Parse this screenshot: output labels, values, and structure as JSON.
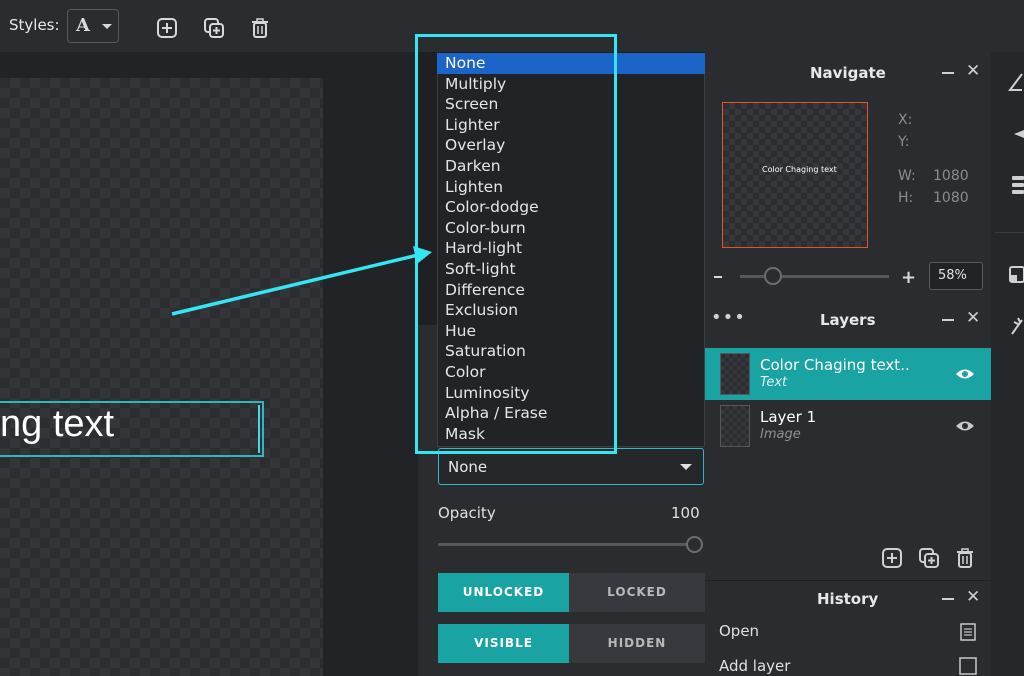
{
  "toolbar": {
    "styles_label": "Styles:",
    "styles_glyph": "A",
    "icons": [
      "add-square-icon",
      "duplicate-icon",
      "trash-icon"
    ]
  },
  "canvas": {
    "visible_text": "ng text"
  },
  "blend_mode": {
    "options": [
      "None",
      "Multiply",
      "Screen",
      "Lighter",
      "Overlay",
      "Darken",
      "Lighten",
      "Color-dodge",
      "Color-burn",
      "Hard-light",
      "Soft-light",
      "Difference",
      "Exclusion",
      "Hue",
      "Saturation",
      "Color",
      "Luminosity",
      "Alpha / Erase",
      "Mask"
    ],
    "selected": "None",
    "highlight_color": "#35e6f2"
  },
  "properties": {
    "opacity_label": "Opacity",
    "opacity_value": "100",
    "opacity_fraction": 1.0,
    "lock": {
      "unlocked": "UNLOCKED",
      "locked": "LOCKED",
      "active": "unlocked"
    },
    "visibility": {
      "visible": "VISIBLE",
      "hidden": "HIDDEN",
      "active": "visible"
    }
  },
  "navigate": {
    "title": "Navigate",
    "preview_text": "Color Chaging text",
    "x_label": "X:",
    "y_label": "Y:",
    "w_label": "W:",
    "w_value": "1080",
    "h_label": "H:",
    "h_value": "1080",
    "zoom_minus": "-",
    "zoom_plus": "+",
    "zoom_value": "58%"
  },
  "layers": {
    "title": "Layers",
    "items": [
      {
        "name": "Color Chaging text..",
        "type": "Text",
        "active": true
      },
      {
        "name": "Layer 1",
        "type": "Image",
        "active": false
      }
    ]
  },
  "history": {
    "title": "History",
    "items": [
      "Open",
      "Add layer"
    ]
  },
  "colors": {
    "accent": "#1aa3a3",
    "selection": "#1c64c8",
    "nav_border": "#e0562b"
  }
}
